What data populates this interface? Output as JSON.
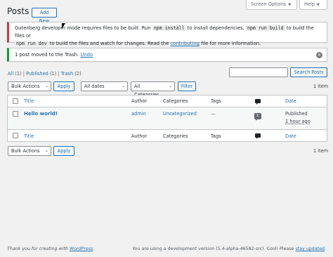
{
  "header": {
    "title": "Posts",
    "add_new": "Add New",
    "screen_options": "Screen Options",
    "help": "Help"
  },
  "notice_error": {
    "line1_a": "Gutenberg developm",
    "line1_b": "mode requires files to be built. Run",
    "code1": "npm install",
    "line1_c": "to install dependencies,",
    "code2": "npm run build",
    "line1_d": "to build the files or",
    "code3": "npm run dev",
    "line2_a": "to build the files and watch for changes. Read the",
    "link": "contributing",
    "line2_b": "file for more information."
  },
  "notice_success": {
    "text": "1 post moved to the Trash.",
    "undo": "Undo"
  },
  "filters_views": {
    "all": "All",
    "all_count": "(1)",
    "published": "Published",
    "published_count": "(1)",
    "trash": "Trash",
    "trash_count": "(2)",
    "sep": "|"
  },
  "search": {
    "value": "",
    "button": "Search Posts"
  },
  "tablenav_top": {
    "bulk_actions": "Bulk Actions",
    "apply": "Apply",
    "dates": "All dates",
    "categories": "All Categories",
    "filter": "Filter",
    "items": "1 item"
  },
  "table": {
    "columns": {
      "title": "Title",
      "author": "Author",
      "categories": "Categories",
      "tags": "Tags",
      "date": "Date"
    },
    "rows": [
      {
        "title": "Hello world!",
        "author": "admin",
        "category": "Uncategorized",
        "tags": "—",
        "comments": "1",
        "status": "Published",
        "date": "1 hour ago"
      }
    ]
  },
  "tablenav_bottom": {
    "bulk_actions": "Bulk Actions",
    "apply": "Apply",
    "items": "1 item"
  },
  "footer": {
    "thanks_prefix": "Thank you for creating with",
    "thanks_link": "WordPress",
    "thanks_suffix": ".",
    "version_prefix": "You are using a development version (5.4-alpha-46582-src). Cool! Please",
    "version_link": "stay updated",
    "version_suffix": "."
  },
  "colors": {
    "accent": "#2271b1",
    "error": "#d63638",
    "success": "#00a32a",
    "background": "#f1f1f1"
  }
}
